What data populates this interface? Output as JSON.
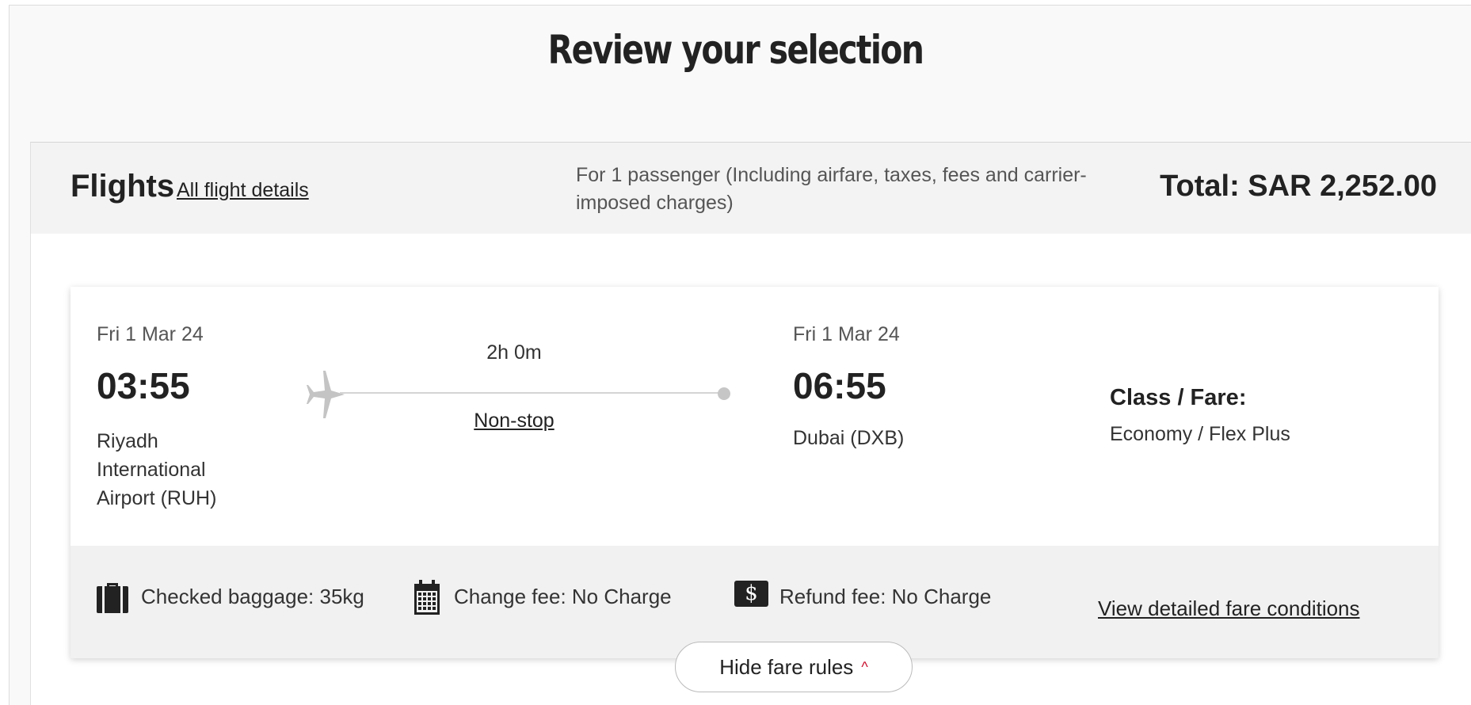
{
  "page": {
    "title": "Review your selection"
  },
  "flights_header": {
    "title": "Flights",
    "all_details_link": "All flight details",
    "passenger_note": "For 1 passenger (Including airfare, taxes, fees and carrier-imposed charges)",
    "total": "Total: SAR 2,252.00"
  },
  "flight": {
    "departure": {
      "date": "Fri 1 Mar 24",
      "time": "03:55",
      "airport": "Riyadh International Airport (RUH)"
    },
    "arrival": {
      "date": "Fri 1 Mar 24",
      "time": "06:55",
      "airport": "Dubai (DXB)"
    },
    "duration": "2h 0m",
    "stops": "Non-stop",
    "class_label": "Class / Fare:",
    "class_value": "Economy / Flex Plus"
  },
  "fare_rules": {
    "baggage": {
      "icon": "baggage-icon",
      "text": "Checked baggage: 35kg"
    },
    "change": {
      "icon": "calendar-icon",
      "text": "Change fee: No Charge"
    },
    "refund": {
      "icon": "dollar-icon",
      "symbol": "$",
      "text": "Refund fee: No Charge"
    },
    "view_conditions_link": "View detailed fare conditions",
    "hide_button": "Hide fare rules",
    "hide_button_icon": "chevron-up-icon"
  },
  "colors": {
    "accent": "#c8102e",
    "header_bg": "#f3f3f3",
    "rules_bg": "#f1f1f1"
  }
}
